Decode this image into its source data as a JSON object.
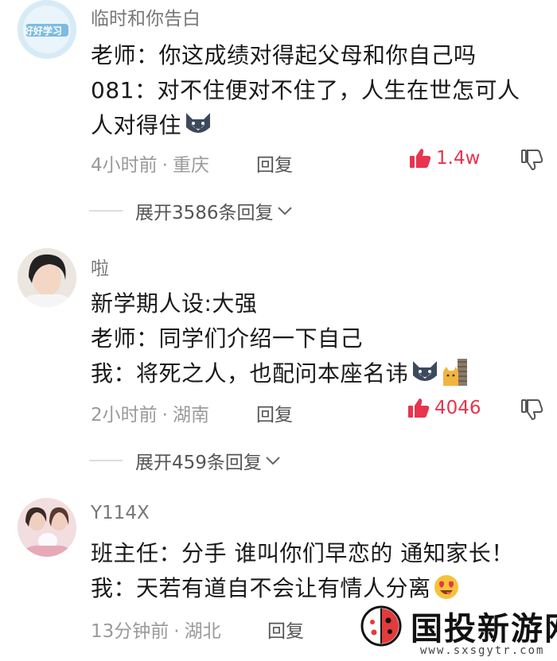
{
  "comments": [
    {
      "username": "临时和你告白",
      "lines": [
        "老师：你这成绩对得起父母和你自己吗",
        "081：对不住便对不住了，人生在世怎可人",
        "人对得住"
      ],
      "time": "4小时前",
      "location": "重庆",
      "reply_label": "回复",
      "likes": "1.4w",
      "expand_label": "展开3586条回复",
      "avatar_text": "好好学习"
    },
    {
      "username": "啦",
      "lines": [
        "新学期人设:大强",
        "老师：同学们介绍一下自己",
        "我：将死之人，也配问本座名讳"
      ],
      "time": "2小时前",
      "location": "湖南",
      "reply_label": "回复",
      "likes": "4046",
      "expand_label": "展开459条回复"
    },
    {
      "username": "Y114X",
      "lines": [
        "班主任：分手 谁叫你们早恋的 通知家长！",
        "我：天若有道自不会让有情人分离"
      ],
      "time": "13分钟前",
      "location": "湖北",
      "reply_label": "回复"
    }
  ],
  "meta_separator": "·",
  "watermark": {
    "name": "国投新游网",
    "url": "www.sxsgytr.com"
  },
  "colors": {
    "like": "#e8344e",
    "meta": "#9a9a9a",
    "text": "#1a1a1a"
  }
}
